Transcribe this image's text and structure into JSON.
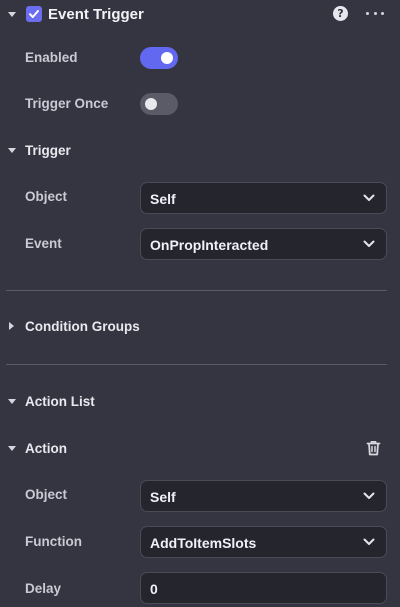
{
  "header": {
    "title": "Event Trigger",
    "help_icon": "question-circle-icon",
    "more_icon": "ellipsis-icon",
    "checked": true
  },
  "enabled": {
    "label": "Enabled",
    "value": true
  },
  "trigger_once": {
    "label": "Trigger Once",
    "value": false
  },
  "trigger_section": {
    "label": "Trigger",
    "object_label": "Object",
    "object_value": "Self",
    "event_label": "Event",
    "event_value": "OnPropInteracted"
  },
  "condition_groups": {
    "label": "Condition Groups"
  },
  "action_list": {
    "label": "Action List"
  },
  "action": {
    "label": "Action",
    "delete_icon": "trash-icon",
    "object_label": "Object",
    "object_value": "Self",
    "function_label": "Function",
    "function_value": "AddToItemSlots",
    "delay_label": "Delay",
    "delay_value": "0"
  },
  "colors": {
    "background": "#343540",
    "accent": "#6368f0",
    "field_bg": "#24252d"
  }
}
